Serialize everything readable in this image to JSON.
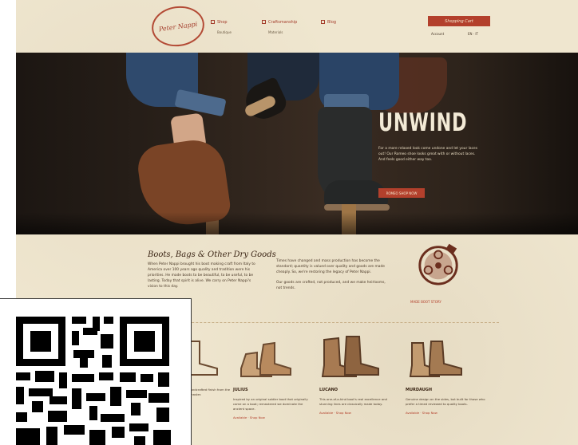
{
  "header": {
    "logo_text": "Peter Nappi",
    "nav": [
      {
        "label": "Shop",
        "sub": "Boutique"
      },
      {
        "label": "Craftsmanship",
        "sub": "Materials"
      },
      {
        "label": "Blog",
        "sub": ""
      }
    ],
    "shop_button": "Shopping Cart",
    "util": [
      "Account",
      "EN · IT"
    ]
  },
  "hero": {
    "title": "UNWIND",
    "text": "For a more relaxed look come undone and let your laces out! Our Romeo shoe looks great with or without laces. And feels good either way too.",
    "button": "ROMEO SHOP NOW"
  },
  "intro": {
    "title": "Boots, Bags & Other Dry Goods",
    "col1": "When Peter Nappi brought his boot making craft from Italy to America over 100 years ago quality and tradition were his priorities. He made boots to be beautiful, to be useful, to be lasting. Today that spirit is alive. We carry on Peter Nappi's vision to this day.",
    "col2_p1": "Times have changed and mass production has become the standard; quantity is valued over quality and goods are made cheaply. So, we're restoring the legacy of Peter Nappi.",
    "col2_p2": "Our goods are crafted, not produced, and we make heirlooms, not trends.",
    "badge_label": "MADE BOOT STORY"
  },
  "products": [
    {
      "name": "",
      "desc": "A classic boot with a handcrafted finish from the leathers of the Italian master.",
      "link": "Available · Shop Now"
    },
    {
      "name": "JULIUS",
      "desc": "Inspired by an original soldier boot that originally came on a boat; remastered we dominate the ancient space.",
      "link": "Available · Shop Now"
    },
    {
      "name": "LUCANO",
      "desc": "This one-of-a-kind boot's real excellence and stunning lines are classically made today.",
      "link": "Available · Shop Now"
    },
    {
      "name": "MURDAUGH",
      "desc": "Genuine design on the sides, but built for those who prefer a timed reviewed to quality boots.",
      "link": "Available · Shop Now"
    }
  ],
  "colors": {
    "accent": "#b3402c",
    "background": "#efe6cf",
    "text": "#3a2414"
  }
}
